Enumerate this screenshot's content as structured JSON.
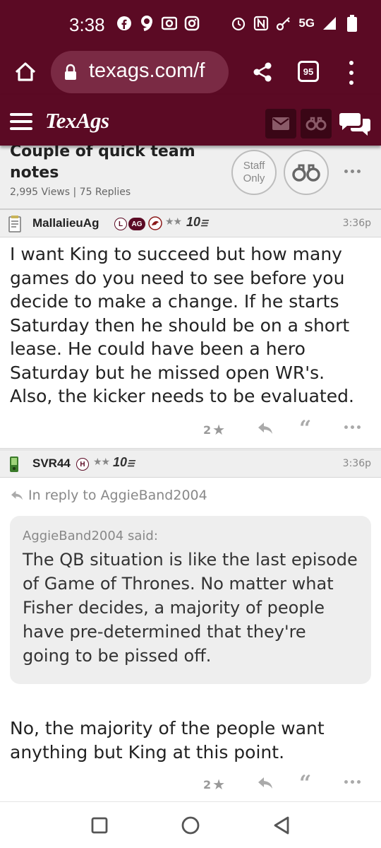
{
  "status_bar": {
    "time": "3:38",
    "network": "5G",
    "icons": [
      "facebook-icon",
      "app-9-icon",
      "camera-icon",
      "instagram-icon",
      "alarm-icon",
      "nfc-icon",
      "key-icon",
      "signal-icon",
      "battery-icon"
    ]
  },
  "browser": {
    "url": "texags.com/f",
    "tab_count": "95"
  },
  "site": {
    "logo": "TexAgs",
    "accent_color": "#5b0a24"
  },
  "topic": {
    "title": "Couple of quick team notes",
    "stats": "2,995 Views | 75 Replies",
    "staff_label": "Staff Only"
  },
  "posts": [
    {
      "username": "MallalieuAg",
      "badge_letter": "L",
      "badge_ag": "AG",
      "stars": "★★",
      "years": "10",
      "time": "3:36p",
      "body": "I want King to succeed but how many games do you need to see before you decide to make a change. If he starts Saturday then he should be on a short lease. He could have been a hero Saturday but he missed open WR's. Also, the kicker needs to be evaluated.",
      "likes": "2"
    },
    {
      "username": "SVR44",
      "badge_letter": "H",
      "stars": "★★",
      "years": "10",
      "time": "3:36p",
      "reply_to": "In reply to AggieBand2004",
      "quote_author": "AggieBand2004 said:",
      "quote_text": "The QB situation is like the last episode of Game of Thrones. No matter what Fisher decides, a majority of people have pre-determined that they're going to be pissed off.",
      "body": "No, the majority of the people want anything but King at this point.",
      "likes": "2"
    }
  ]
}
